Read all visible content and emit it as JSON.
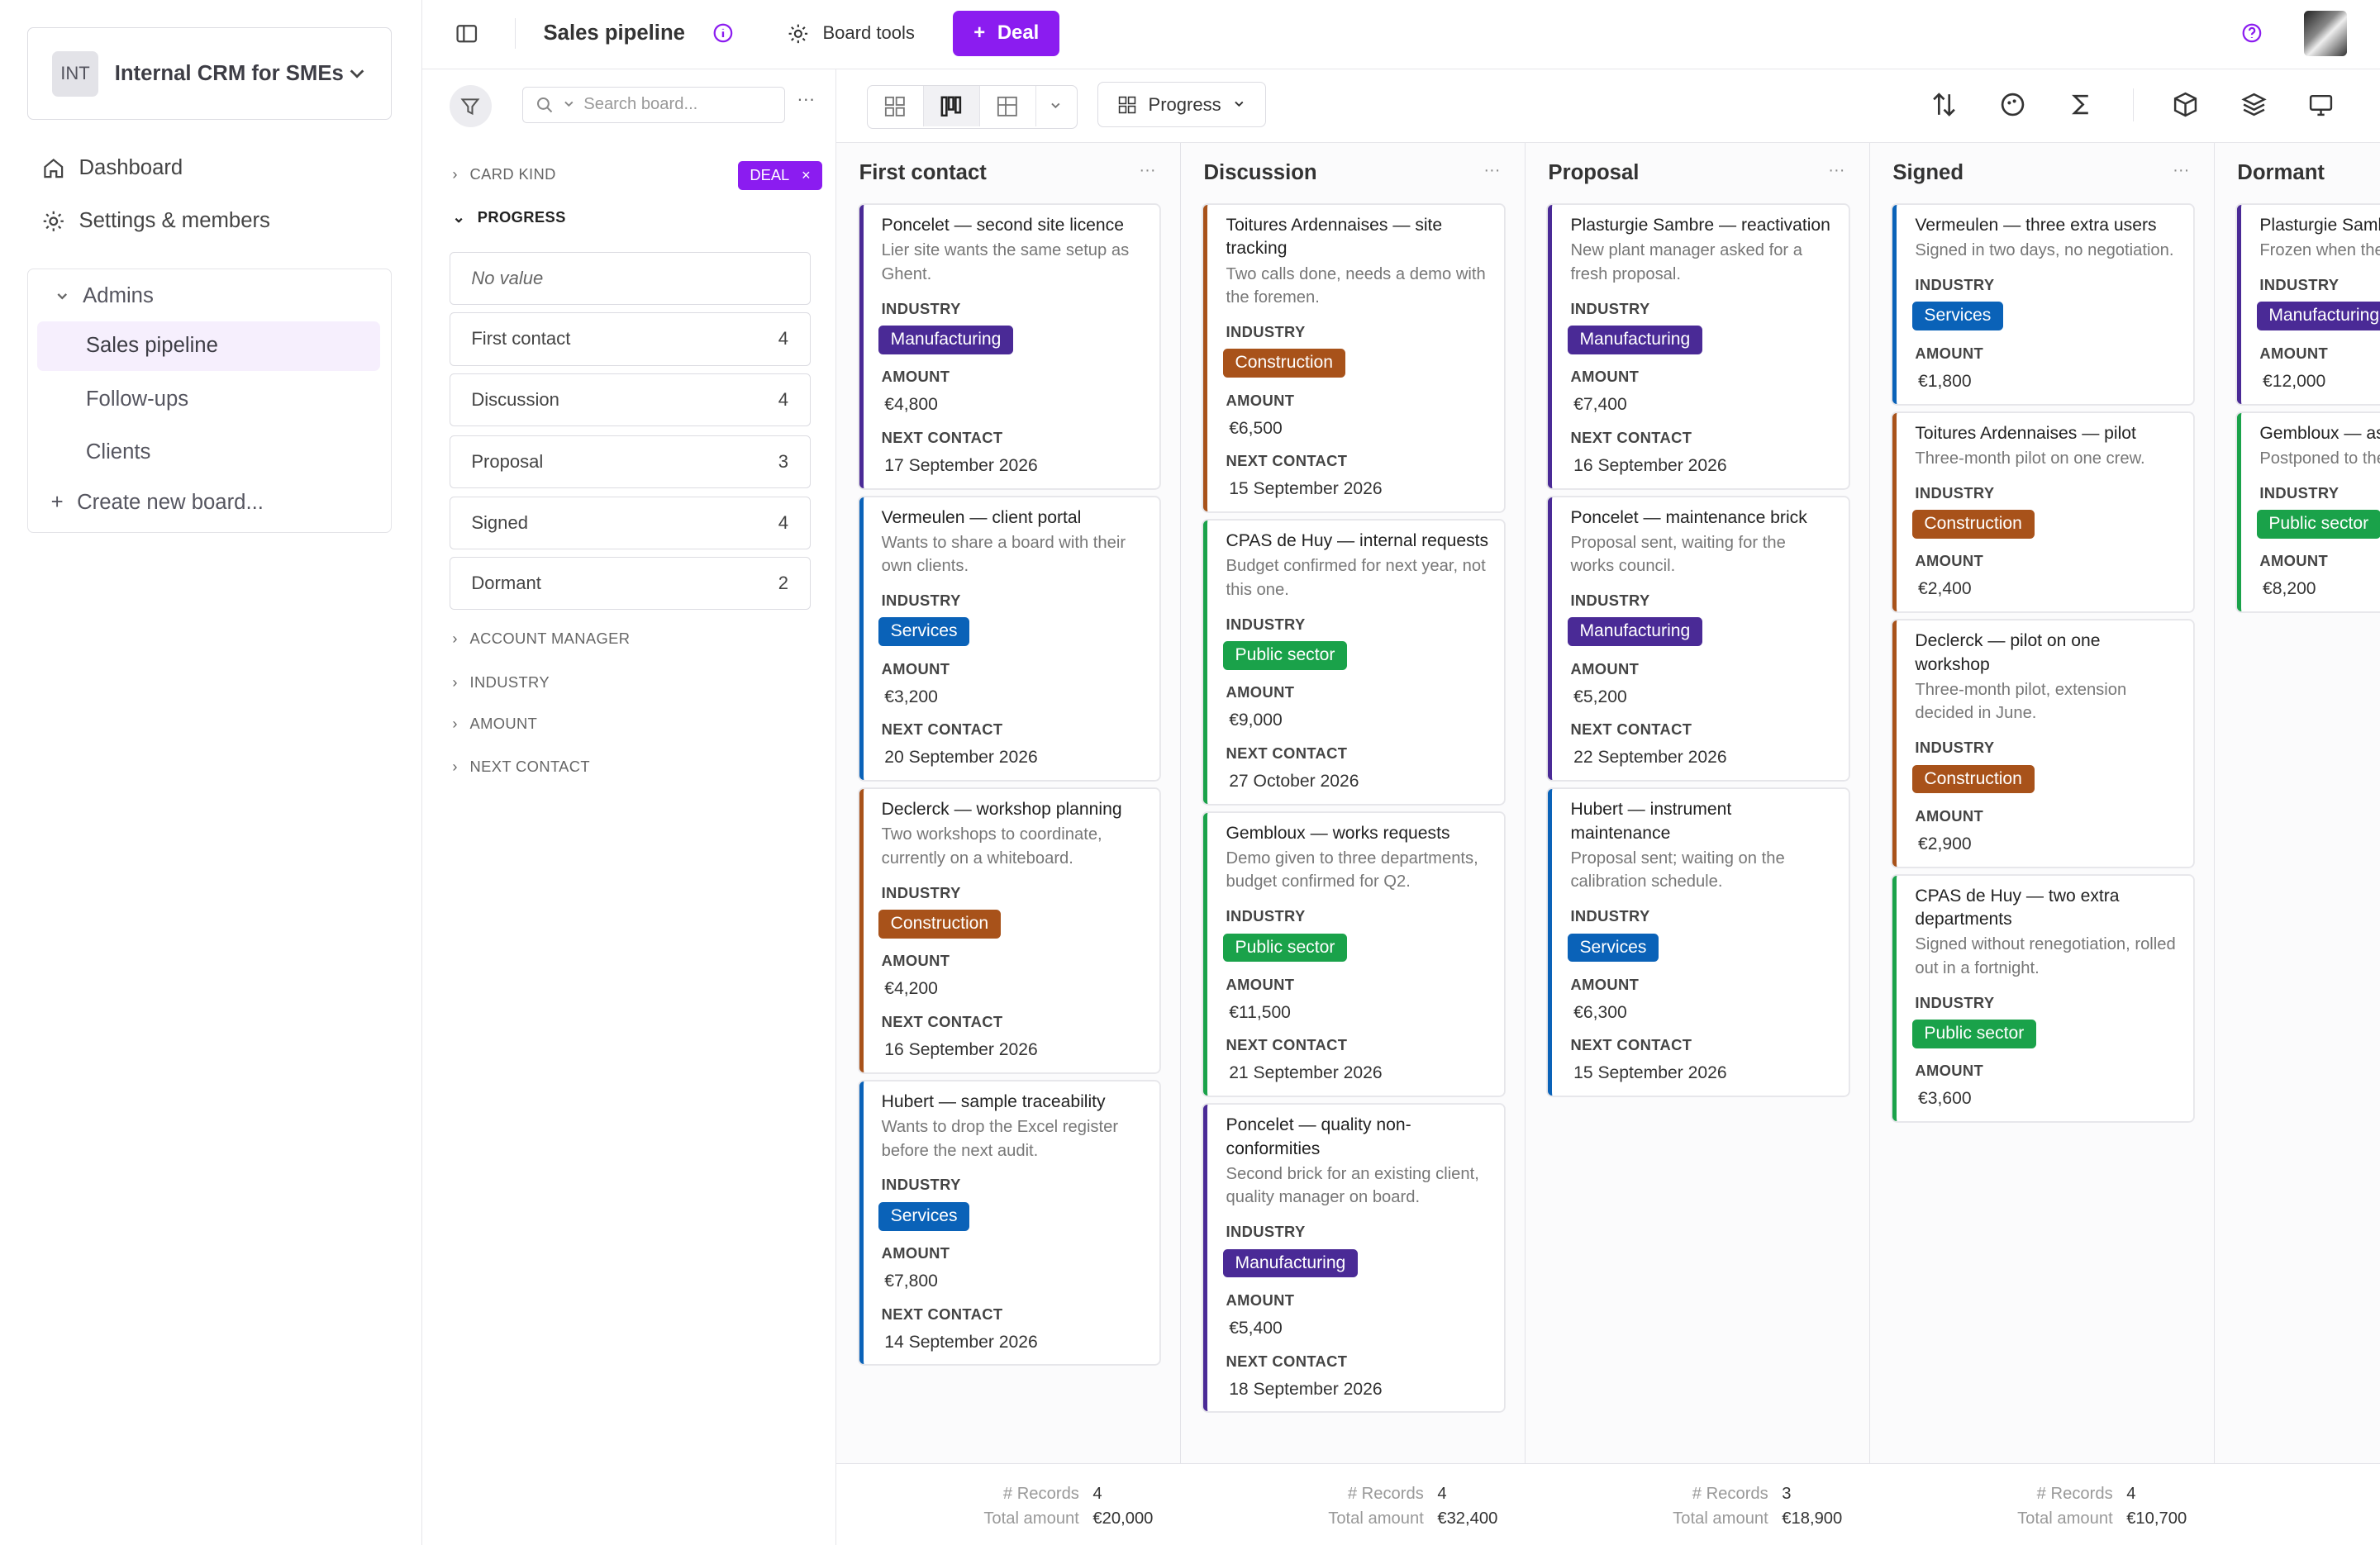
{
  "workspace": {
    "badge": "INT",
    "name": "Internal CRM for SMEs"
  },
  "nav": {
    "dashboard": "Dashboard",
    "settings": "Settings & members"
  },
  "group": {
    "title": "Admins",
    "items": [
      "Sales pipeline",
      "Follow-ups",
      "Clients"
    ],
    "create": "Create new board..."
  },
  "topbar": {
    "title": "Sales pipeline",
    "board_tools": "Board tools",
    "deal_button": "Deal"
  },
  "filters": {
    "search_placeholder": "Search board...",
    "card_kind": "CARD KIND",
    "card_kind_tag": "DEAL",
    "progress": "PROGRESS",
    "options": [
      {
        "label": "No value",
        "count": ""
      },
      {
        "label": "First contact",
        "count": "4"
      },
      {
        "label": "Discussion",
        "count": "4"
      },
      {
        "label": "Proposal",
        "count": "3"
      },
      {
        "label": "Signed",
        "count": "4"
      },
      {
        "label": "Dormant",
        "count": "2"
      }
    ],
    "account_manager": "ACCOUNT MANAGER",
    "industry": "INDUSTRY",
    "amount": "AMOUNT",
    "next_contact": "NEXT CONTACT"
  },
  "toolbar": {
    "group_by": "Progress"
  },
  "labels": {
    "industry": "INDUSTRY",
    "amount": "AMOUNT",
    "next_contact": "NEXT CONTACT",
    "records": "# Records",
    "total": "Total amount"
  },
  "colors": {
    "accent": "#8b1cf0",
    "Manufacturing": "#4a2a96",
    "Services": "#0a62b8",
    "Construction": "#a8521a",
    "Public sector": "#1aa24a"
  },
  "columns": [
    {
      "name": "First contact",
      "records": "4",
      "total": "€20,000",
      "cards": [
        {
          "title": "Poncelet — second site licence",
          "desc": "Lier site wants the same setup as Ghent.",
          "industry": "Manufacturing",
          "amount": "€4,800",
          "next": "17 September 2026"
        },
        {
          "title": "Vermeulen — client portal",
          "desc": "Wants to share a board with their own clients.",
          "industry": "Services",
          "amount": "€3,200",
          "next": "20 September 2026"
        },
        {
          "title": "Declerck — workshop planning",
          "desc": "Two workshops to coordinate, currently on a whiteboard.",
          "industry": "Construction",
          "amount": "€4,200",
          "next": "16 September 2026"
        },
        {
          "title": "Hubert — sample traceability",
          "desc": "Wants to drop the Excel register before the next audit.",
          "industry": "Services",
          "amount": "€7,800",
          "next": "14 September 2026"
        }
      ]
    },
    {
      "name": "Discussion",
      "records": "4",
      "total": "€32,400",
      "cards": [
        {
          "title": "Toitures Ardennaises — site tracking",
          "desc": "Two calls done, needs a demo with the foremen.",
          "industry": "Construction",
          "amount": "€6,500",
          "next": "15 September 2026"
        },
        {
          "title": "CPAS de Huy — internal requests",
          "desc": "Budget confirmed for next year, not this one.",
          "industry": "Public sector",
          "amount": "€9,000",
          "next": "27 October 2026"
        },
        {
          "title": "Gembloux — works requests",
          "desc": "Demo given to three departments, budget confirmed for Q2.",
          "industry": "Public sector",
          "amount": "€11,500",
          "next": "21 September 2026"
        },
        {
          "title": "Poncelet — quality non-conformities",
          "desc": "Second brick for an existing client, quality manager on board.",
          "industry": "Manufacturing",
          "amount": "€5,400",
          "next": "18 September 2026"
        }
      ]
    },
    {
      "name": "Proposal",
      "records": "3",
      "total": "€18,900",
      "cards": [
        {
          "title": "Plasturgie Sambre — reactivation",
          "desc": "New plant manager asked for a fresh proposal.",
          "industry": "Manufacturing",
          "amount": "€7,400",
          "next": "16 September 2026"
        },
        {
          "title": "Poncelet — maintenance brick",
          "desc": "Proposal sent, waiting for the works council.",
          "industry": "Manufacturing",
          "amount": "€5,200",
          "next": "22 September 2026"
        },
        {
          "title": "Hubert — instrument maintenance",
          "desc": "Proposal sent; waiting on the calibration schedule.",
          "industry": "Services",
          "amount": "€6,300",
          "next": "15 September 2026"
        }
      ]
    },
    {
      "name": "Signed",
      "records": "4",
      "total": "€10,700",
      "cards": [
        {
          "title": "Vermeulen — three extra users",
          "desc": "Signed in two days, no negotiation.",
          "industry": "Services",
          "amount": "€1,800",
          "next": ""
        },
        {
          "title": "Toitures Ardennaises — pilot",
          "desc": "Three-month pilot on one crew.",
          "industry": "Construction",
          "amount": "€2,400",
          "next": ""
        },
        {
          "title": "Declerck — pilot on one workshop",
          "desc": "Three-month pilot, extension decided in June.",
          "industry": "Construction",
          "amount": "€2,900",
          "next": ""
        },
        {
          "title": "CPAS de Huy — two extra departments",
          "desc": "Signed without renegotiation, rolled out in a fortnight.",
          "industry": "Public sector",
          "amount": "€3,600",
          "next": ""
        }
      ]
    },
    {
      "name": "Dormant",
      "records": "",
      "total": "",
      "cards": [
        {
          "title": "Plasturgie Sambre — project",
          "desc": "Frozen when the kept for the histo",
          "industry": "Manufacturing",
          "amount": "€12,000",
          "next": ""
        },
        {
          "title": "Gembloux — as",
          "desc": "Postponed to the cycle, contact ke",
          "industry": "Public sector",
          "amount": "€8,200",
          "next": ""
        }
      ]
    }
  ]
}
